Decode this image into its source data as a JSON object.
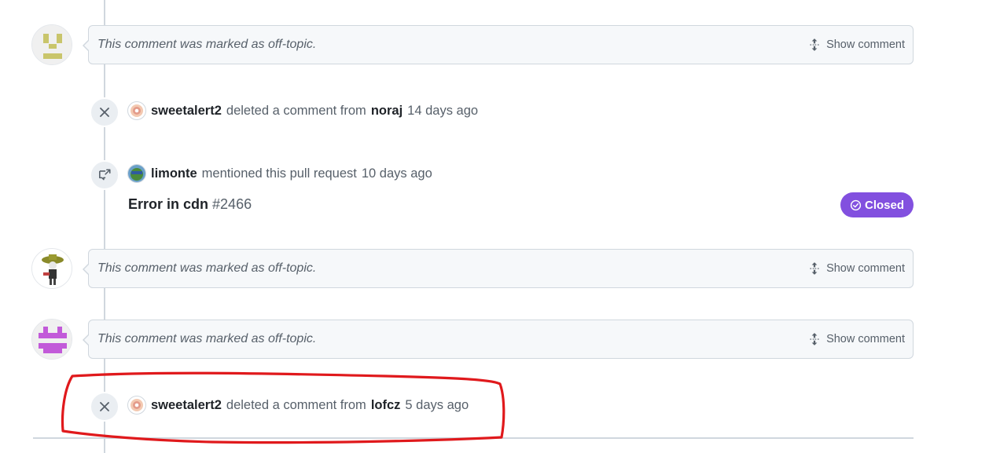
{
  "timeline": {
    "collapsed_comments": [
      {
        "text": "This comment was marked as off-topic.",
        "show_label": "Show comment",
        "avatar_icon": "identicon-yellow"
      },
      {
        "text": "This comment was marked as off-topic.",
        "show_label": "Show comment",
        "avatar_icon": "skeleton-sombrero-avatar"
      },
      {
        "text": "This comment was marked as off-topic.",
        "show_label": "Show comment",
        "avatar_icon": "identicon-purple"
      }
    ],
    "deleted_events": [
      {
        "actor": "sweetalert2",
        "action": "deleted a comment from",
        "target": "noraj",
        "time": "14 days ago",
        "icon": "x-icon"
      },
      {
        "actor": "sweetalert2",
        "action": "deleted a comment from",
        "target": "lofcz",
        "time": "5 days ago",
        "icon": "x-icon"
      }
    ],
    "mention_event": {
      "actor": "limonte",
      "action": "mentioned this pull request",
      "time": "10 days ago",
      "icon": "cross-reference-icon",
      "xref_title": "Error in cdn",
      "xref_number": "#2466",
      "status_label": "Closed"
    }
  },
  "colors": {
    "closed_badge": "#8250df",
    "annotation": "#e0191c",
    "identicon_yellow": "#c9c56b",
    "identicon_purple": "#c25ad9"
  }
}
